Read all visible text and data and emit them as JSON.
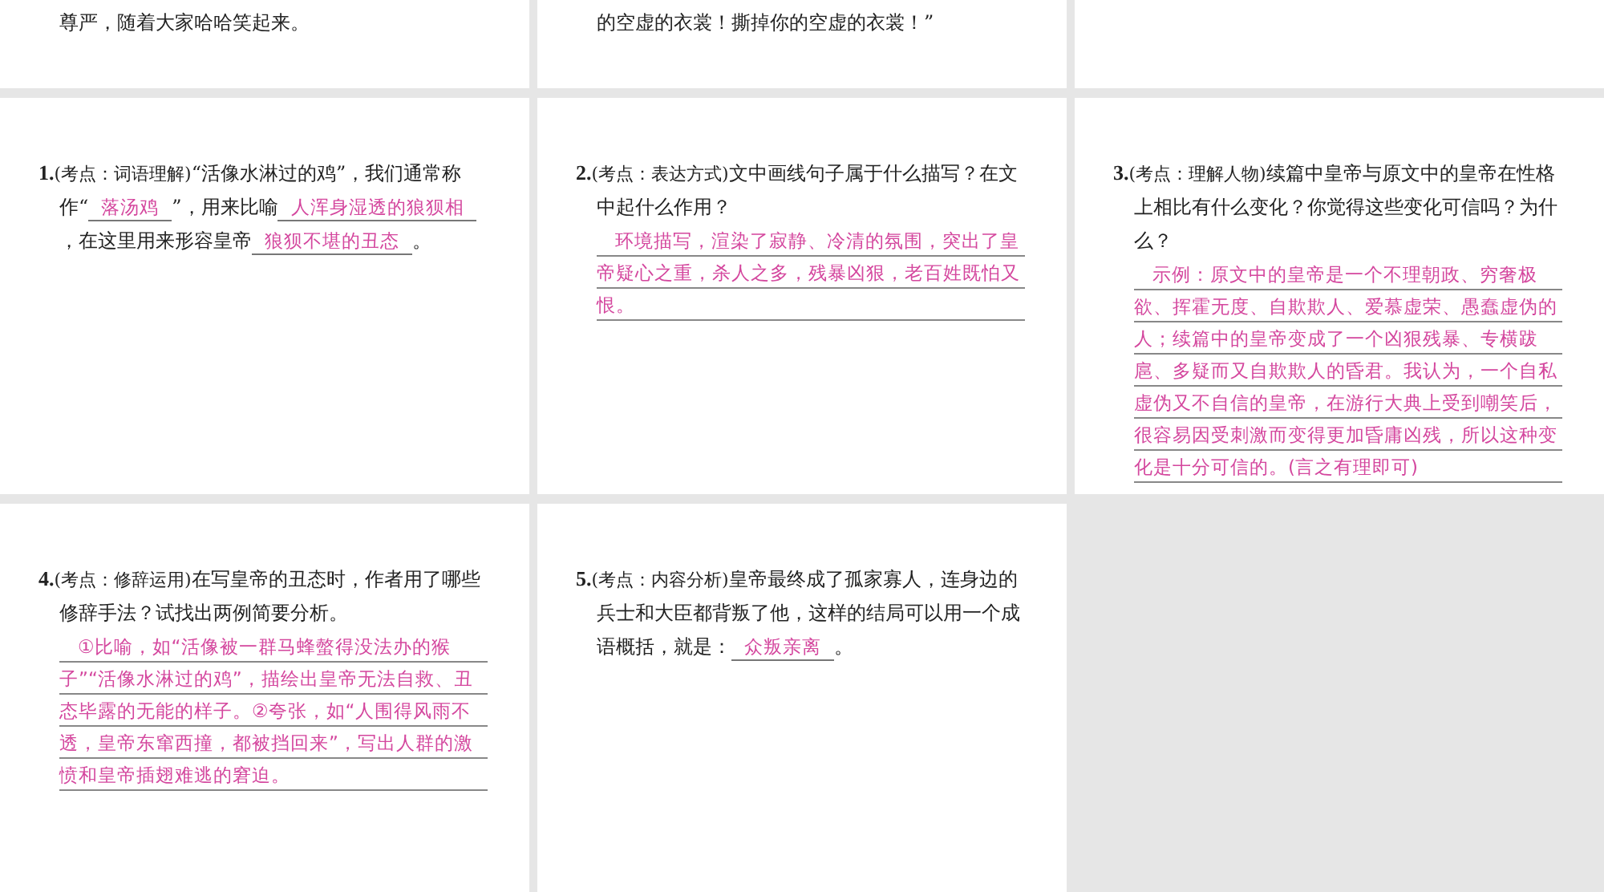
{
  "top_row": [
    {
      "text": "尊严，随着大家哈哈笑起来。"
    },
    {
      "text": "的空虚的衣裳！撕掉你的空虚的衣裳！”"
    }
  ],
  "questions": [
    {
      "number": "1.",
      "tag": "(考点：词语理解)",
      "segments": [
        {
          "kind": "text",
          "text": "“活像水淋过的鸡”，我们通常称作“"
        },
        {
          "kind": "blank",
          "text": "落汤鸡"
        },
        {
          "kind": "text",
          "text": "”，用来比喻"
        },
        {
          "kind": "blank",
          "text": "人浑身湿透的狼狈相"
        },
        {
          "kind": "text",
          "text": "，在这里用来形容皇帝"
        },
        {
          "kind": "blank",
          "text": "狼狈不堪的丑态"
        },
        {
          "kind": "text",
          "text": "。"
        }
      ]
    },
    {
      "number": "2.",
      "tag": "(考点：表达方式)",
      "segments": [
        {
          "kind": "text",
          "text": "文中画线句子属于什么描写？在文中起什么作用？"
        }
      ],
      "answer": "环境描写，渲染了寂静、冷清的氛围，突出了皇帝疑心之重，杀人之多，残暴凶狠，老百姓既怕又恨。"
    },
    {
      "number": "3.",
      "tag": "(考点：理解人物)",
      "segments": [
        {
          "kind": "text",
          "text": "续篇中皇帝与原文中的皇帝在性格上相比有什么变化？你觉得这些变化可信吗？为什么？"
        }
      ],
      "answer": "示例：原文中的皇帝是一个不理朝政、穷奢极欲、挥霍无度、自欺欺人、爱慕虚荣、愚蠢虚伪的人；续篇中的皇帝变成了一个凶狠残暴、专横跋扈、多疑而又自欺欺人的昏君。我认为，一个自私虚伪又不自信的皇帝，在游行大典上受到嘲笑后，很容易因受刺激而变得更加昏庸凶残，所以这种变化是十分可信的。(言之有理即可)"
    },
    {
      "number": "4.",
      "tag": "(考点：修辞运用)",
      "segments": [
        {
          "kind": "text",
          "text": "在写皇帝的丑态时，作者用了哪些修辞手法？试找出两例简要分析。"
        }
      ],
      "answer": "①比喻，如“活像被一群马蜂螫得没法办的猴子”“活像水淋过的鸡”，描绘出皇帝无法自救、丑态毕露的无能的样子。②夸张，如“人围得风雨不透，皇帝东窜西撞，都被挡回来”，写出人群的激愤和皇帝插翅难逃的窘迫。"
    },
    {
      "number": "5.",
      "tag": "(考点：内容分析)",
      "segments": [
        {
          "kind": "text",
          "text": "皇帝最终成了孤家寡人，连身边的兵士和大臣都背叛了他，这样的结局可以用一个成语概括，就是："
        },
        {
          "kind": "blank",
          "text": "众叛亲离"
        },
        {
          "kind": "text",
          "text": "。"
        }
      ]
    }
  ]
}
